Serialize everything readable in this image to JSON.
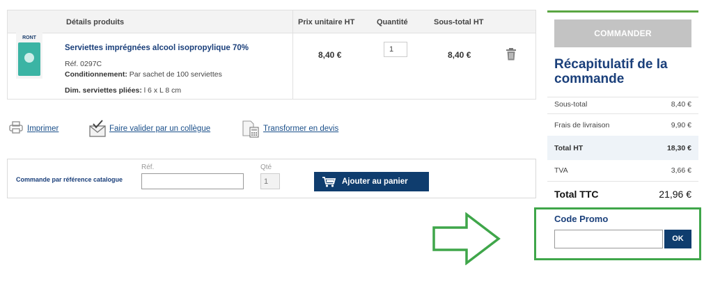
{
  "cart": {
    "headers": {
      "details": "Détails produits",
      "unit_price": "Prix unitaire HT",
      "quantity": "Quantité",
      "subtotal": "Sous-total HT"
    },
    "item": {
      "thumb_brand": "RONT",
      "name": "Serviettes imprégnées alcool isopropylique 70%",
      "ref": "Réf. 0297C",
      "cond_label": "Conditionnement:",
      "cond_value": " Par sachet de 100 serviettes",
      "dim_label": "Dim. serviettes pliées:",
      "dim_value": " l 6 x L 8 cm",
      "unit_price": "8,40 €",
      "quantity": "1",
      "subtotal": "8,40 €"
    }
  },
  "actions": {
    "print": "Imprimer",
    "validate": "Faire valider par un collègue",
    "quote": "Transformer en devis"
  },
  "quick_order": {
    "title": "Commande par référence catalogue",
    "ref_label": "Réf.",
    "qty_label": "Qté",
    "qty_value": "1",
    "add_button": "Ajouter au panier"
  },
  "summary": {
    "order_button": "COMMANDER",
    "title": "Récapitulatif de la commande",
    "rows": [
      {
        "label": "Sous-total",
        "value": "8,40 €"
      },
      {
        "label": "Frais de livraison",
        "value": "9,90 €"
      },
      {
        "label": "Total HT",
        "value": "18,30 €"
      },
      {
        "label": "TVA",
        "value": "3,66 €"
      },
      {
        "label": "Total TTC",
        "value": "21,96 €"
      }
    ]
  },
  "promo": {
    "title": "Code Promo",
    "button": "OK"
  },
  "colors": {
    "brand_blue": "#0f3d6e",
    "link_blue": "#1a4f8a",
    "highlight_green": "#3fa64a",
    "disabled_gray": "#c3c3c3"
  }
}
